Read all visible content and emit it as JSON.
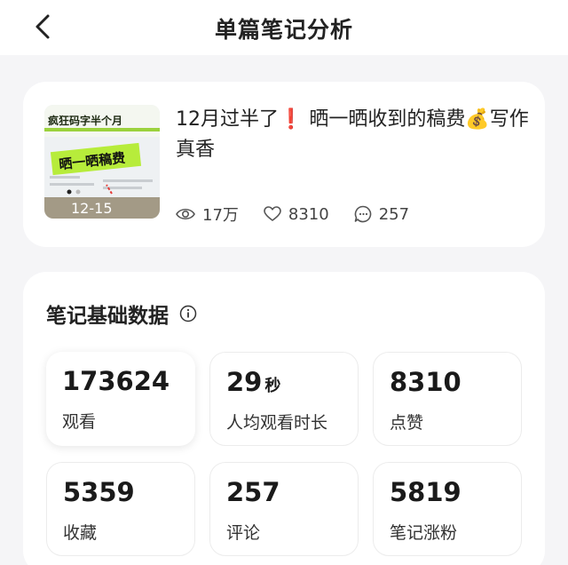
{
  "header": {
    "title": "单篇笔记分析"
  },
  "note": {
    "title": "12月过半了❗ 晒一晒收到的稿费💰写作真香",
    "thumbnail": {
      "headline": "疯狂码字半个月",
      "banner": "晒一晒稿费",
      "date_range": "12-15"
    },
    "stats": {
      "views": "17万",
      "likes": "8310",
      "comments": "257"
    }
  },
  "basic_data": {
    "title": "笔记基础数据",
    "metrics": [
      {
        "value": "173624",
        "unit": "",
        "label": "观看"
      },
      {
        "value": "29",
        "unit": "秒",
        "label": "人均观看时长"
      },
      {
        "value": "8310",
        "unit": "",
        "label": "点赞"
      },
      {
        "value": "5359",
        "unit": "",
        "label": "收藏"
      },
      {
        "value": "257",
        "unit": "",
        "label": "评论"
      },
      {
        "value": "5819",
        "unit": "",
        "label": "笔记涨粉"
      }
    ]
  }
}
